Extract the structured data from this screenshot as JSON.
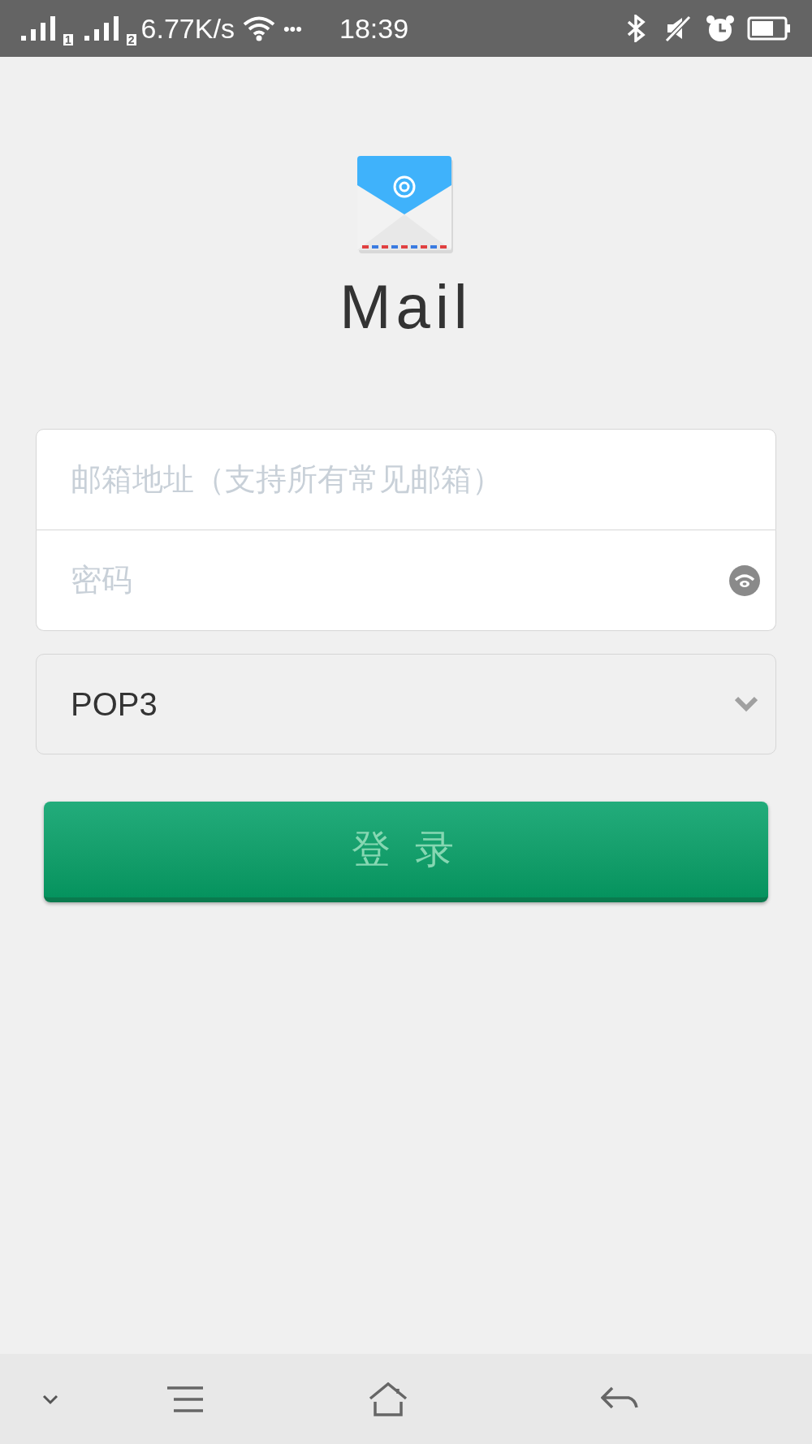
{
  "status_bar": {
    "sim_1": "1",
    "sim_2": "2",
    "speed": "6.77K/s",
    "more": "•••",
    "time": "18:39"
  },
  "app": {
    "title": "Mail"
  },
  "form": {
    "email": {
      "placeholder": "邮箱地址（支持所有常见邮箱）"
    },
    "password": {
      "placeholder": "密码"
    },
    "protocol": {
      "value": "POP3"
    },
    "login_button": "登 录"
  }
}
